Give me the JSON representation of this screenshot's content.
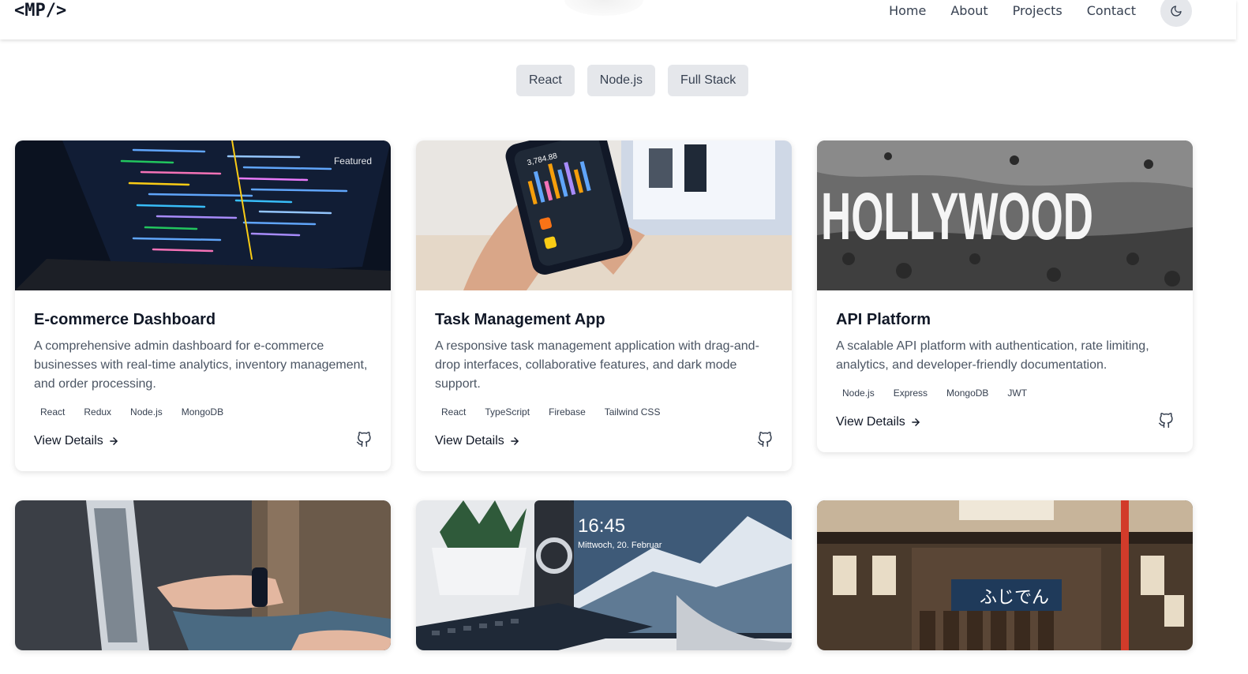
{
  "header": {
    "logo": "<MP/>",
    "nav": [
      "Home",
      "About",
      "Projects",
      "Contact"
    ],
    "theme_icon": "moon-icon"
  },
  "filters": [
    "React",
    "Node.js",
    "Full Stack"
  ],
  "projects": [
    {
      "title": "E-commerce Dashboard",
      "description": "A comprehensive admin dashboard for e-commerce businesses with real-time analytics, inventory management, and order processing.",
      "tags": [
        "React",
        "Redux",
        "Node.js",
        "MongoDB"
      ],
      "badge": "Featured",
      "link": "View Details",
      "icon": "github-icon"
    },
    {
      "title": "Task Management App",
      "description": "A responsive task management application with drag-and-drop interfaces, collaborative features, and dark mode support.",
      "tags": [
        "React",
        "TypeScript",
        "Firebase",
        "Tailwind CSS"
      ],
      "link": "View Details",
      "icon": "github-icon"
    },
    {
      "title": "API Platform",
      "description": "A scalable API platform with authentication, rate limiting, analytics, and developer-friendly documentation.",
      "tags": [
        "Node.js",
        "Express",
        "MongoDB",
        "JWT"
      ],
      "link": "View Details",
      "icon": "github-icon"
    }
  ],
  "image_texts": {
    "phone_amount": "3,784.88",
    "hollywood": "HOLLYWOOD",
    "clock_time": "16:45",
    "clock_date": "Mittwoch, 20. Februar",
    "shop_sign": "ふじでん"
  }
}
